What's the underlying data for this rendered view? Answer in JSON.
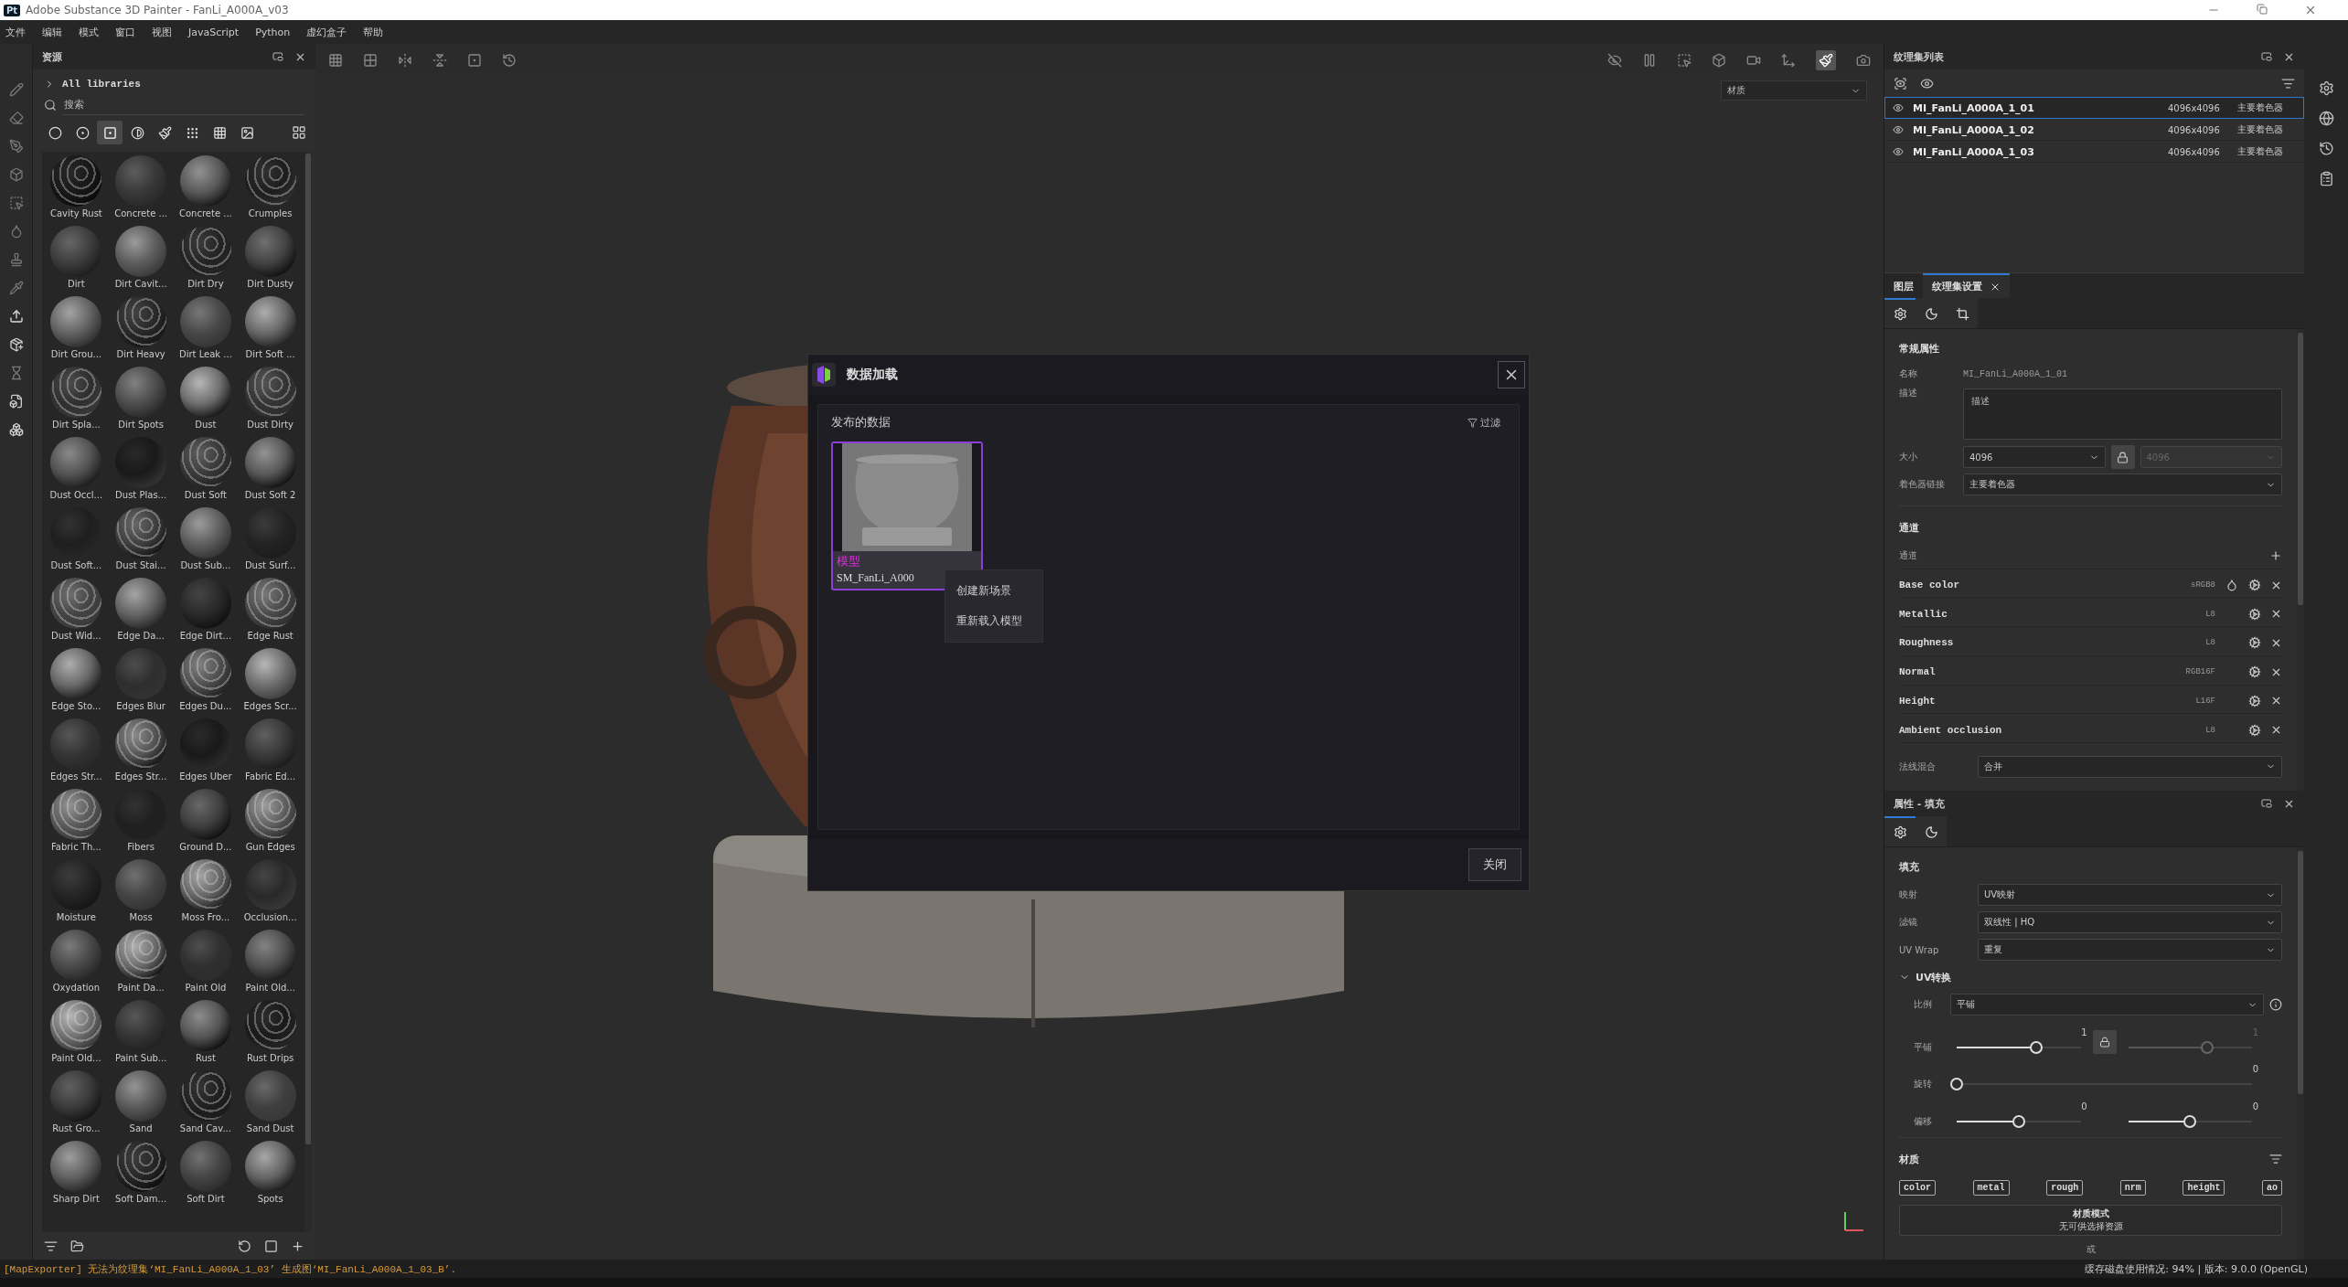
{
  "title_bar": {
    "app_icon": "Pt",
    "title": "Adobe Substance 3D Painter - FanLi_A000A_v03"
  },
  "menu": [
    "文件",
    "编辑",
    "模式",
    "窗口",
    "视图",
    "JavaScript",
    "Python",
    "虚幻盒子",
    "帮助"
  ],
  "assets": {
    "title": "资源",
    "library": "All libraries",
    "search": {
      "placeholder": "搜索"
    },
    "filters": [
      {
        "kind": "material",
        "selected": false
      },
      {
        "kind": "smart-material",
        "selected": false
      },
      {
        "kind": "mask",
        "selected": true
      },
      {
        "kind": "smart-mask",
        "selected": false
      },
      {
        "kind": "brush",
        "selected": false
      },
      {
        "kind": "alpha",
        "selected": false
      },
      {
        "kind": "texture",
        "selected": false
      },
      {
        "kind": "environment",
        "selected": false
      }
    ],
    "items": [
      "Cavity Rust",
      "Concrete ...",
      "Concrete ...",
      "Crumples",
      "Dirt",
      "Dirt Cavit...",
      "Dirt Dry",
      "Dirt Dusty",
      "Dirt Grou...",
      "Dirt Heavy",
      "Dirt Leak ...",
      "Dirt Soft ...",
      "Dirt Spla...",
      "Dirt Spots",
      "Dust",
      "Dust Dirty",
      "Dust Occl...",
      "Dust Plas...",
      "Dust Soft",
      "Dust Soft 2",
      "Dust Soft...",
      "Dust Stai...",
      "Dust Sub...",
      "Dust Surf...",
      "Dust Wid...",
      "Edge Da...",
      "Edge Dirt...",
      "Edge Rust",
      "Edge Sto...",
      "Edges Blur",
      "Edges Du...",
      "Edges Scr...",
      "Edges Str...",
      "Edges Str...",
      "Edges Uber",
      "Fabric Ed...",
      "Fabric Th...",
      "Fibers",
      "Ground D...",
      "Gun Edges",
      "Moisture",
      "Moss",
      "Moss Fro...",
      "Occlusion...",
      "Oxydation",
      "Paint Da...",
      "Paint Old",
      "Paint Old...",
      "Paint Old...",
      "Paint Sub...",
      "Rust",
      "Rust Drips",
      "Rust Gro...",
      "Sand",
      "Sand Cav...",
      "Sand Dust",
      "Sharp Dirt",
      "Soft Dam...",
      "Soft Dirt",
      "Spots"
    ]
  },
  "viewport": {
    "shading_mode": "材质"
  },
  "dialog": {
    "title": "数据加载",
    "section": "发布的数据",
    "filter": "过滤",
    "cards": [
      {
        "type": "模型",
        "name": "SM_FanLi_A000",
        "selected": true
      }
    ],
    "context_menu": [
      "创建新场景",
      "重新载入模型"
    ],
    "close": "关闭"
  },
  "texture_sets": {
    "title": "纹理集列表",
    "rows": [
      {
        "name": "MI_FanLi_A000A_1_01",
        "size": "4096x4096",
        "shader": "主要着色器",
        "selected": true
      },
      {
        "name": "MI_FanLi_A000A_1_02",
        "size": "4096x4096",
        "shader": "主要着色器",
        "selected": false
      },
      {
        "name": "MI_FanLi_A000A_1_03",
        "size": "4096x4096",
        "shader": "主要着色器",
        "selected": false
      }
    ]
  },
  "tabs": [
    {
      "label": "图层",
      "selected": false,
      "closable": false
    },
    {
      "label": "纹理集设置",
      "selected": true,
      "closable": true
    }
  ],
  "settings": {
    "icon_tabs": [
      {
        "kind": "settings",
        "selected": true
      },
      {
        "kind": "shader",
        "selected": false
      },
      {
        "kind": "uv",
        "selected": false
      }
    ],
    "general": {
      "heading": "常规属性",
      "name_label": "名称",
      "name": "MI_FanLi_A000A_1_01",
      "desc_label": "描述",
      "desc_placeholder": "描述",
      "size_label": "大小",
      "size": "4096",
      "size_locked": true,
      "size_linked": "4096",
      "shader_label": "着色器链接",
      "shader": "主要着色器"
    },
    "channels": {
      "heading": "通道",
      "add_label": "通道",
      "rows": [
        {
          "name": "Base color",
          "format": "sRGB8",
          "color_icon": true
        },
        {
          "name": "Metallic",
          "format": "L8",
          "color_icon": false
        },
        {
          "name": "Roughness",
          "format": "L8",
          "color_icon": false
        },
        {
          "name": "Normal",
          "format": "RGB16F",
          "color_icon": false
        },
        {
          "name": "Height",
          "format": "L16F",
          "color_icon": false
        },
        {
          "name": "Ambient occlusion",
          "format": "L8",
          "color_icon": false
        }
      ]
    },
    "normal_mix": {
      "label": "法线混合",
      "value": "合并"
    }
  },
  "properties": {
    "title": "属性 - 填充",
    "icon_tabs": [
      {
        "kind": "settings",
        "selected": true
      },
      {
        "kind": "shader",
        "selected": false
      }
    ],
    "fill": {
      "heading": "填充",
      "rows": [
        {
          "label": "映射",
          "value": "UV映射"
        },
        {
          "label": "滤镜",
          "value": "双线性 | HQ"
        },
        {
          "label": "UV Wrap",
          "value": "重复"
        }
      ]
    },
    "uv_transform": {
      "heading": "UV转换",
      "expanded": true,
      "scale": {
        "label": "比例",
        "value": "平铺"
      },
      "sliders": [
        {
          "label": "平铺",
          "locked": true,
          "parts": [
            {
              "value": "1",
              "level": 0.64,
              "disabled": false
            },
            {
              "value": "1",
              "level": 0.64,
              "disabled": true
            }
          ]
        },
        {
          "label": "旋转",
          "locked": false,
          "parts": [
            {
              "value": "0",
              "level": 0,
              "disabled": false
            }
          ]
        },
        {
          "label": "偏移",
          "locked": false,
          "parts": [
            {
              "value": "0",
              "level": 0.5,
              "disabled": false
            },
            {
              "value": "0",
              "level": 0.5,
              "disabled": false
            }
          ]
        }
      ]
    },
    "material": {
      "heading": "材质",
      "channels": [
        "color",
        "metal",
        "rough",
        "nrm",
        "height",
        "ao"
      ],
      "mode_title": "材质模式",
      "mode_note": "无可供选择资源",
      "or": "或"
    }
  },
  "status_bar": {
    "message": "[MapExporter] 无法为纹理集‘MI_FanLi_A000A_1_03’ 生成图‘MI_FanLi_A000A_1_03_B’.",
    "info": "缓存磁盘使用情况:  94% | 版本: 9.0.0 (OpenGL)"
  }
}
